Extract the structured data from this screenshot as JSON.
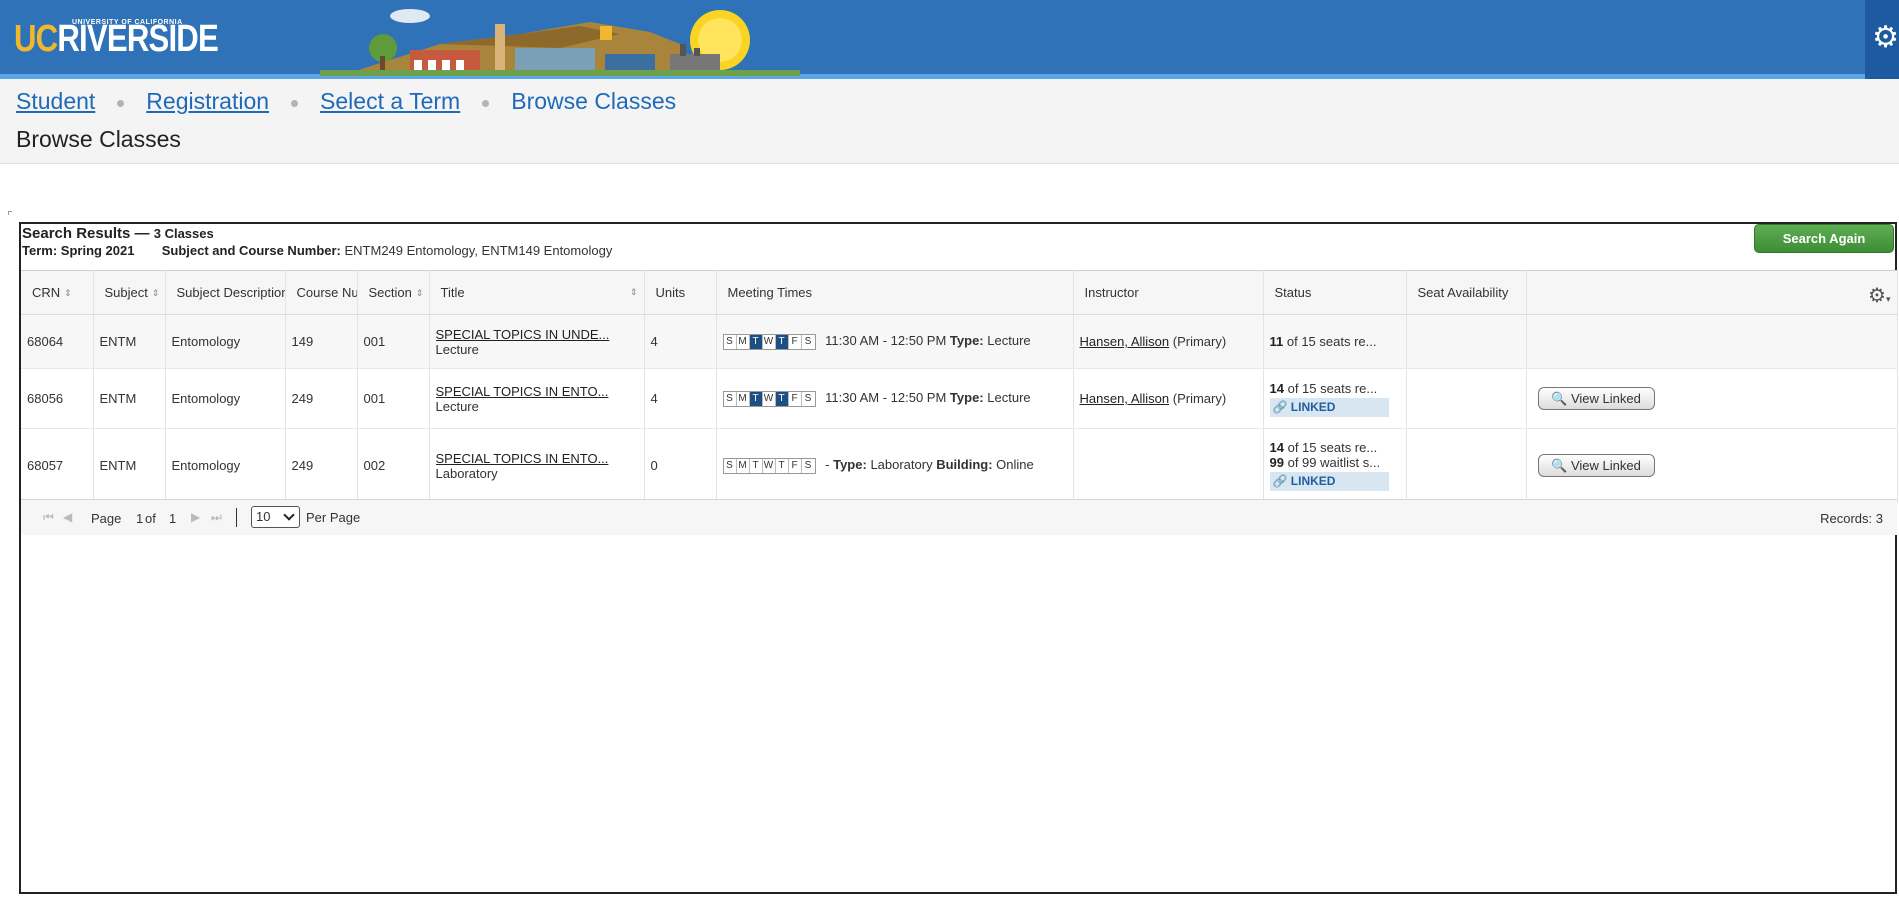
{
  "header": {
    "logo_uc": "UC",
    "logo_riverside": "RIVERSIDE",
    "logo_sub": "UNIVERSITY OF CALIFORNIA"
  },
  "breadcrumb": {
    "items": [
      "Student",
      "Registration",
      "Select a Term",
      "Browse Classes"
    ]
  },
  "page_title": "Browse Classes",
  "results": {
    "title": "Search Results —",
    "count": "3 Classes",
    "term_label": "Term:",
    "term_value": "Spring 2021",
    "subject_label": "Subject and Course Number:",
    "subject_value": "ENTM249 Entomology, ENTM149 Entomology",
    "search_again": "Search Again"
  },
  "columns": [
    "CRN",
    "Subject",
    "Subject Description",
    "Course Number",
    "Section",
    "Title",
    "Units",
    "Meeting Times",
    "Instructor",
    "Status",
    "Seat Availability"
  ],
  "rows": [
    {
      "crn": "68064",
      "subject": "ENTM",
      "desc": "Entomology",
      "course": "149",
      "section": "001",
      "title": "SPECIAL TOPICS IN UNDE...",
      "schedule_type": "Lecture",
      "units": "4",
      "days": [
        "S",
        "M",
        "T",
        "W",
        "T",
        "F",
        "S"
      ],
      "days_on": [
        false,
        false,
        true,
        false,
        true,
        false,
        false
      ],
      "time": "11:30 AM - 12:50 PM",
      "type_label": "Type:",
      "type_value": "Lecture",
      "instructor": "Hansen, Allison",
      "instructor_role": "(Primary)",
      "seats_num": "11",
      "seats_text": "of 15 seats re...",
      "waitlist_num": "",
      "waitlist_text": "",
      "linked": "",
      "view_linked": ""
    },
    {
      "crn": "68056",
      "subject": "ENTM",
      "desc": "Entomology",
      "course": "249",
      "section": "001",
      "title": "SPECIAL TOPICS IN ENTO...",
      "schedule_type": "Lecture",
      "units": "4",
      "days": [
        "S",
        "M",
        "T",
        "W",
        "T",
        "F",
        "S"
      ],
      "days_on": [
        false,
        false,
        true,
        false,
        true,
        false,
        false
      ],
      "time": "11:30 AM - 12:50 PM",
      "type_label": "Type:",
      "type_value": "Lecture",
      "instructor": "Hansen, Allison",
      "instructor_role": "(Primary)",
      "seats_num": "14",
      "seats_text": "of 15 seats re...",
      "waitlist_num": "",
      "waitlist_text": "",
      "linked": "LINKED",
      "view_linked": "View Linked"
    },
    {
      "crn": "68057",
      "subject": "ENTM",
      "desc": "Entomology",
      "course": "249",
      "section": "002",
      "title": "SPECIAL TOPICS IN ENTO...",
      "schedule_type": "Laboratory",
      "units": "0",
      "days": [
        "S",
        "M",
        "T",
        "W",
        "T",
        "F",
        "S"
      ],
      "days_on": [
        false,
        false,
        false,
        false,
        false,
        false,
        false
      ],
      "time": "-",
      "type_label": "Type:",
      "type_value": "Laboratory",
      "building_label": "Building:",
      "building_value": "Online",
      "instructor": "",
      "instructor_role": "",
      "seats_num": "14",
      "seats_text": "of 15 seats re...",
      "waitlist_num": "99",
      "waitlist_text": "of 99 waitlist s...",
      "linked": "LINKED",
      "view_linked": "View Linked"
    }
  ],
  "pager": {
    "page_label": "Page",
    "page_current": "1",
    "of_label": "of",
    "page_total": "1",
    "per_page_value": "10",
    "per_page_label": "Per Page",
    "records": "Records: 3"
  },
  "icons": [
    "settings-gear-icon",
    "column-settings-gear-icon",
    "sort-icon",
    "link-icon",
    "search-icon",
    "first-page-icon",
    "prev-page-icon",
    "next-page-icon",
    "last-page-icon"
  ],
  "colors": {
    "header_blue": "#2f72b8",
    "link_blue": "#1f6ab8",
    "button_green": "#4a9c40",
    "day_on": "#1b4f86",
    "linked_bg": "#d8e6f2",
    "gold": "#f1b82d"
  }
}
